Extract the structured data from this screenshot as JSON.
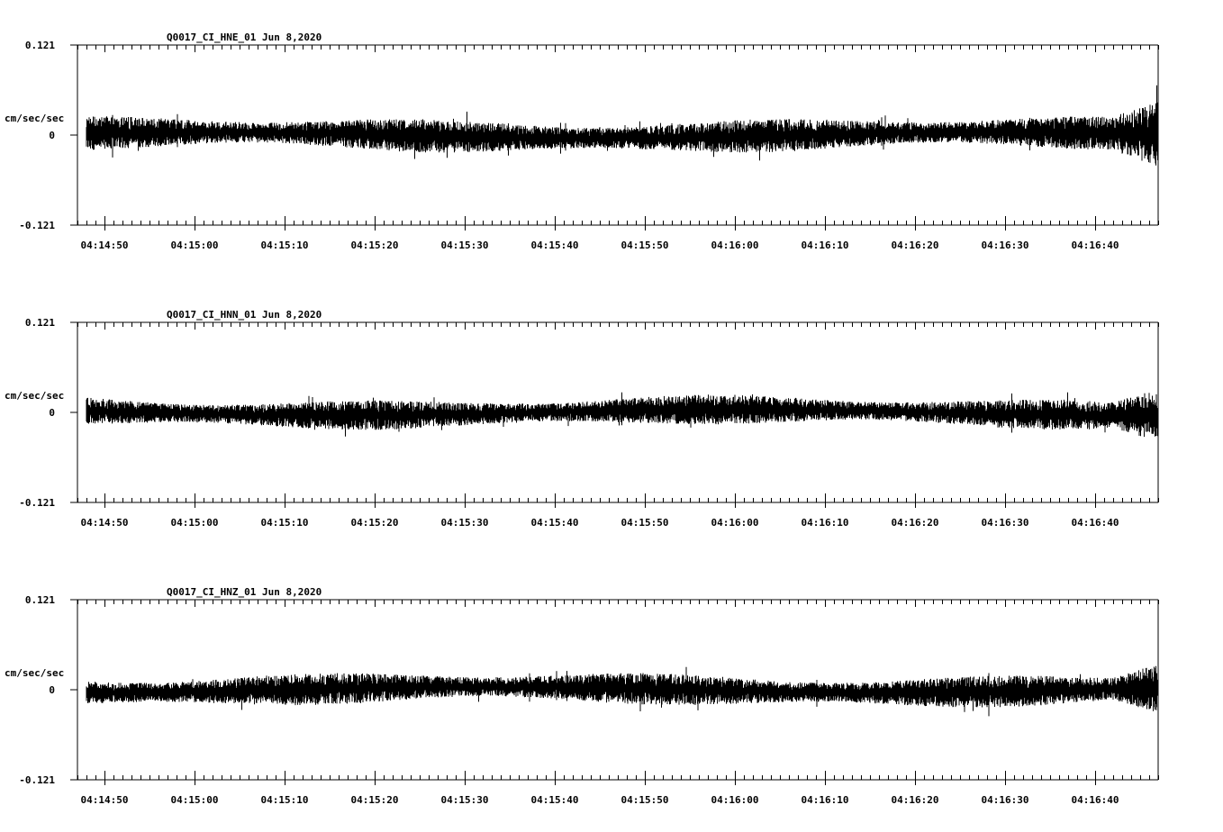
{
  "chart_data": [
    {
      "type": "line",
      "title": "Q0017_CI_HNE_01  Jun 8,2020",
      "ylabel": "cm/sec/sec",
      "ylim": [
        -0.121,
        0.121
      ],
      "y_ticks": [
        "0.121",
        "0",
        "-0.121"
      ],
      "x_tick_labels": [
        "04:14:50",
        "04:15:00",
        "04:15:10",
        "04:15:20",
        "04:15:30",
        "04:15:40",
        "04:15:50",
        "04:16:00",
        "04:16:10",
        "04:16:20",
        "04:16:30",
        "04:16:40"
      ],
      "xlim": [
        "04:14:47",
        "04:16:47"
      ],
      "signal_start": "04:14:48",
      "noise_amplitude": 0.018,
      "grid": false,
      "line_color": "#000000"
    },
    {
      "type": "line",
      "title": "Q0017_CI_HNN_01  Jun 8,2020",
      "ylabel": "cm/sec/sec",
      "ylim": [
        -0.121,
        0.121
      ],
      "y_ticks": [
        "0.121",
        "0",
        "-0.121"
      ],
      "x_tick_labels": [
        "04:14:50",
        "04:15:00",
        "04:15:10",
        "04:15:20",
        "04:15:30",
        "04:15:40",
        "04:15:50",
        "04:16:00",
        "04:16:10",
        "04:16:20",
        "04:16:30",
        "04:16:40"
      ],
      "xlim": [
        "04:14:47",
        "04:16:47"
      ],
      "signal_start": "04:14:48",
      "noise_amplitude": 0.016,
      "grid": false,
      "line_color": "#000000"
    },
    {
      "type": "line",
      "title": "Q0017_CI_HNZ_01  Jun 8,2020",
      "ylabel": "cm/sec/sec",
      "ylim": [
        -0.121,
        0.121
      ],
      "y_ticks": [
        "0.121",
        "0",
        "-0.121"
      ],
      "x_tick_labels": [
        "04:14:50",
        "04:15:00",
        "04:15:10",
        "04:15:20",
        "04:15:30",
        "04:15:40",
        "04:15:50",
        "04:16:00",
        "04:16:10",
        "04:16:20",
        "04:16:30",
        "04:16:40"
      ],
      "xlim": [
        "04:14:47",
        "04:16:47"
      ],
      "signal_start": "04:14:48",
      "noise_amplitude": 0.017,
      "grid": false,
      "line_color": "#000000"
    }
  ]
}
